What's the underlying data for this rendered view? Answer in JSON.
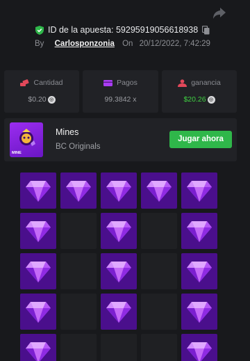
{
  "header": {
    "bet_id_label": "ID de la apuesta: 59295919056618938",
    "by_label": "By",
    "username": "Carlosponzonia",
    "on_label": "On",
    "timestamp": "20/12/2022, 7:42:29"
  },
  "stats": [
    {
      "label": "Cantidad",
      "value": "$0.20",
      "icon": "coins-icon",
      "color": "#e2485a"
    },
    {
      "label": "Pagos",
      "value": "99.3842 x",
      "icon": "wallet-icon",
      "color": "#a93df2"
    },
    {
      "label": "ganancia",
      "value": "$20.26",
      "icon": "person-icon",
      "color": "#e2485a",
      "value_color": "#3fd242"
    }
  ],
  "game": {
    "title": "Mines",
    "provider": "BC Originals",
    "thumb_text": "MINE",
    "play_label": "Jugar ahora"
  },
  "board": {
    "rows": [
      [
        "gem",
        "gem",
        "gem",
        "gem",
        "gem"
      ],
      [
        "gem",
        "empty",
        "gem",
        "empty",
        "gem"
      ],
      [
        "gem",
        "empty",
        "gem",
        "empty",
        "gem"
      ],
      [
        "gem",
        "empty",
        "gem",
        "empty",
        "gem"
      ],
      [
        "gem",
        "empty",
        "empty",
        "empty",
        "gem"
      ]
    ]
  },
  "colors": {
    "accent_green": "#2fb74a",
    "gem_tile": "#4a0f8c",
    "background": "#18191c"
  }
}
